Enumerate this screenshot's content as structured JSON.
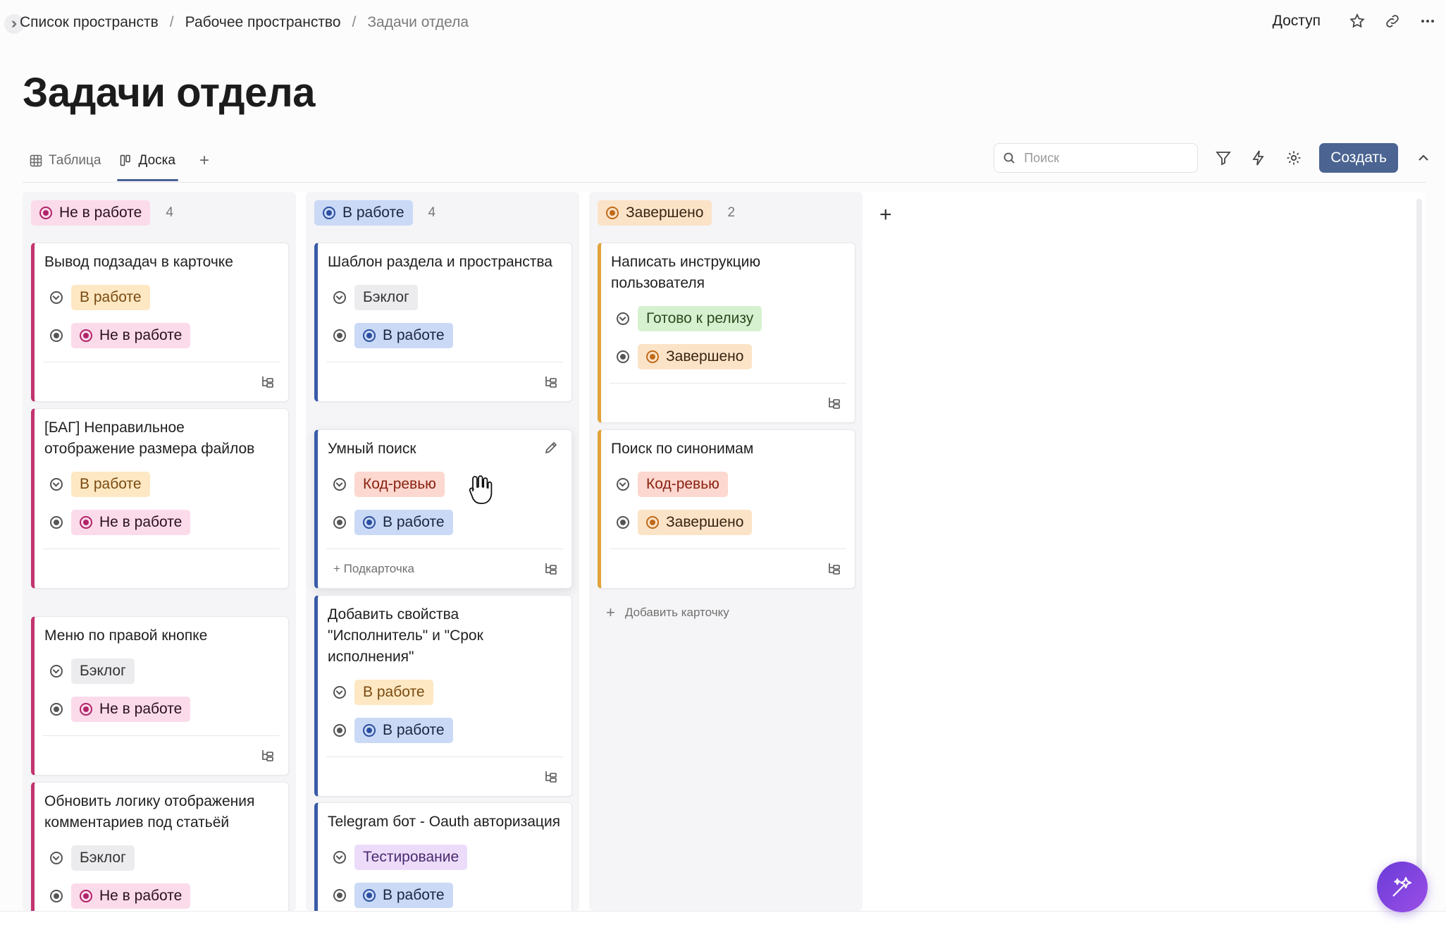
{
  "breadcrumb": {
    "items": [
      "Список пространств",
      "Рабочее пространство",
      "Задачи отдела"
    ],
    "separator": "/"
  },
  "header": {
    "access_label": "Доступ",
    "icons": [
      "star-icon",
      "link-icon",
      "more-icon"
    ]
  },
  "page": {
    "title": "Задачи отдела"
  },
  "tabs": [
    {
      "label": "Таблица",
      "icon": "table-icon",
      "active": false
    },
    {
      "label": "Доска",
      "icon": "board-icon",
      "active": true
    }
  ],
  "toolbar": {
    "search_placeholder": "Поиск",
    "create_label": "Создать",
    "icons": [
      "filter-icon",
      "automation-icon",
      "settings-icon",
      "collapse-icon"
    ]
  },
  "columns": [
    {
      "status": "Не в работе",
      "count": "4",
      "color": "#b0246a",
      "cards": [
        {
          "title": "Вывод подзадач в карточке",
          "priority": "В работе",
          "status": "Не в работе"
        },
        {
          "title": "[БАГ] Неправильное отображение размера файлов",
          "priority": "В работе",
          "status": "Не в работе"
        },
        {
          "title": "Меню по правой кнопке",
          "priority": "Бэклог",
          "status": "Не в работе"
        },
        {
          "title": "Обновить логику отображения комментариев под статьёй",
          "priority": "Бэклог",
          "status": "Не в работе"
        }
      ]
    },
    {
      "status": "В работе",
      "count": "4",
      "color": "#2a4ea0",
      "cards": [
        {
          "title": "Шаблон раздела и пространства",
          "priority": "Бэклог",
          "status": "В работе"
        },
        {
          "title": "Умный поиск",
          "priority": "Код-ревью",
          "status": "В работе",
          "subcard_label": "+ Подкарточка"
        },
        {
          "title": "Добавить свойства \"Исполнитель\" и \"Срок исполнения\"",
          "priority": "В работе",
          "status": "В работе"
        },
        {
          "title": "Telegram бот - Oauth авторизация",
          "priority": "Тестирование",
          "status": "В работе"
        }
      ]
    },
    {
      "status": "Завершено",
      "count": "2",
      "color": "#c06a1a",
      "cards": [
        {
          "title": "Написать инструкцию пользователя",
          "priority": "Готово к релизу",
          "status": "Завершено"
        },
        {
          "title": "Поиск по синонимам",
          "priority": "Код-ревью",
          "status": "Завершено"
        }
      ],
      "add_card_label": "Добавить карточку"
    }
  ],
  "add_column_icon": "plus-icon",
  "fab_icon": "ai-sparkle-icon"
}
